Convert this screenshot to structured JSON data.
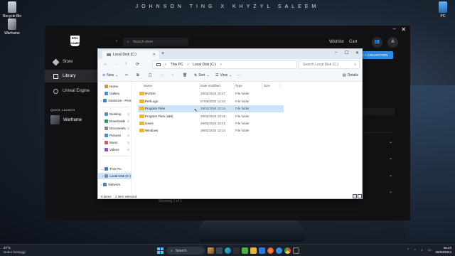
{
  "desktop": {
    "wallpaper_title": "JOHNSON TING   X   KHYZYL SALEEM",
    "icons": [
      {
        "label": "Recycle Bin"
      },
      {
        "label": "Warframe"
      },
      {
        "label": "PC"
      }
    ]
  },
  "epic": {
    "logo_text": "EPIC GAMES",
    "nav": [
      {
        "label": "Store"
      },
      {
        "label": "Library"
      },
      {
        "label": "Unreal Engine"
      }
    ],
    "quick_launch_label": "QUICK LAUNCH",
    "quick_launch_items": [
      {
        "label": "Warframe"
      }
    ],
    "search_placeholder": "Search store",
    "top_links": [
      "Wishlist",
      "Cart"
    ],
    "avatar_initial": "A",
    "collection_button": "E A COLLECTION",
    "showing": "Showing 1 of 1"
  },
  "explorer": {
    "tab_title": "Local Disk (C:)",
    "breadcrumb": [
      "This PC",
      "Local Disk (C:)"
    ],
    "search_placeholder": "Search Local Disk (C:)",
    "commands": {
      "new": "New",
      "sort": "Sort",
      "view": "View",
      "details": "Details"
    },
    "nav_pane": [
      {
        "label": "Home",
        "color": "#e8893a",
        "pinned": false
      },
      {
        "label": "Gallery",
        "color": "#3e8fe0",
        "pinned": false
      },
      {
        "label": "OneDrive - Pers",
        "color": "#2f86d8",
        "pinned": false
      },
      {
        "label": "Desktop",
        "color": "#4a90d9",
        "pinned": true
      },
      {
        "label": "Downloads",
        "color": "#2f9b58",
        "pinned": true
      },
      {
        "label": "Documents",
        "color": "#7a8aa0",
        "pinned": true
      },
      {
        "label": "Pictures",
        "color": "#3f8ed8",
        "pinned": true
      },
      {
        "label": "Music",
        "color": "#e0584c",
        "pinned": true
      },
      {
        "label": "Videos",
        "color": "#8c56c8",
        "pinned": true
      },
      {
        "label": "This PC",
        "color": "#3a7fc9",
        "pinned": false
      },
      {
        "label": "Local Disk (C:)",
        "color": "#8a8f96",
        "pinned": false
      },
      {
        "label": "Network",
        "color": "#3a7fc9",
        "pinned": false
      }
    ],
    "columns": [
      "Name",
      "Date modified",
      "Type",
      "Size"
    ],
    "rows": [
      {
        "name": "NVIDIA",
        "date": "29/02/2024 10:27",
        "type": "File folder",
        "selected": false
      },
      {
        "name": "PerfLogs",
        "date": "07/05/2022 12:24",
        "type": "File folder",
        "selected": false
      },
      {
        "name": "Program Files",
        "date": "29/02/2024 13:14",
        "type": "File folder",
        "selected": true
      },
      {
        "name": "Program Files (x86)",
        "date": "29/02/2024 13:15",
        "type": "File folder",
        "selected": false
      },
      {
        "name": "Users",
        "date": "29/02/2024 10:41",
        "type": "File folder",
        "selected": false
      },
      {
        "name": "Windows",
        "date": "29/02/2024 13:14",
        "type": "File folder",
        "selected": false
      }
    ],
    "status_items": "8 items",
    "status_selected": "1 item selected"
  },
  "taskbar": {
    "weather_temp": "27°C",
    "weather_desc": "Nubur lentingg)",
    "search_label": "Search",
    "time": "06:24",
    "date": "05/03/2024"
  }
}
